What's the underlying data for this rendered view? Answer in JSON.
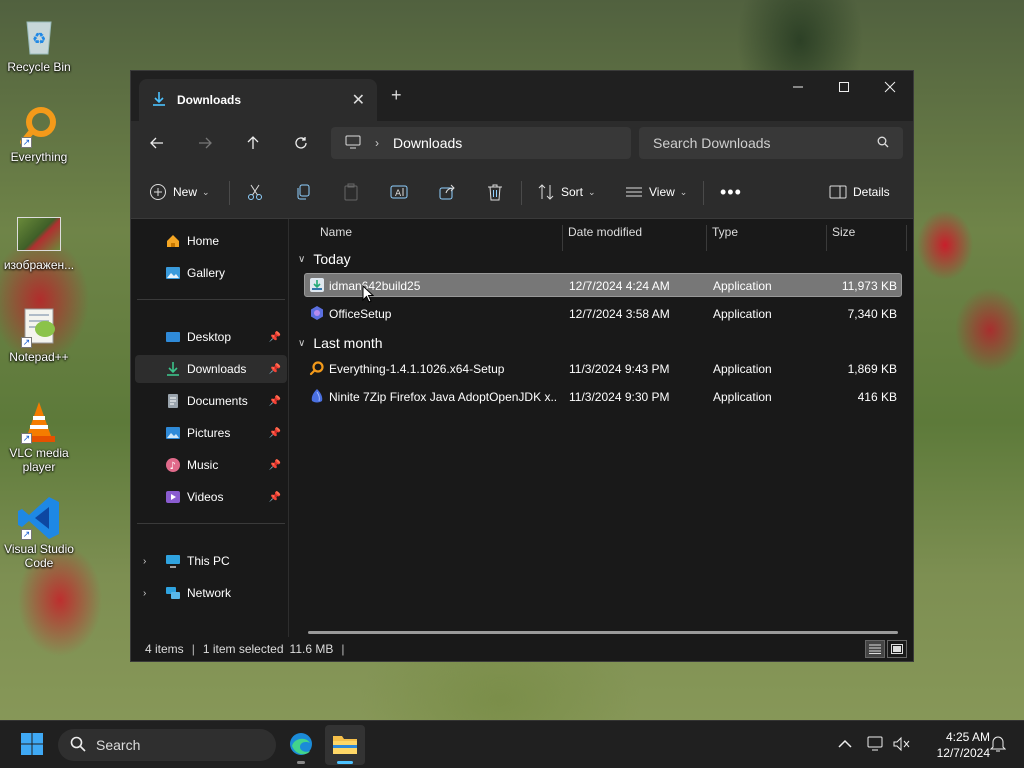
{
  "desktop": {
    "icons": [
      {
        "label": "Recycle Bin",
        "icon": "recycle-bin-icon"
      },
      {
        "label": "Everything",
        "icon": "everything-search-icon"
      },
      {
        "label": "изображен...",
        "icon": "image-thumbnail-icon"
      },
      {
        "label": "Notepad++",
        "icon": "notepad-plus-plus-icon"
      },
      {
        "label": "VLC media player",
        "icon": "vlc-cone-icon"
      },
      {
        "label": "Visual Studio Code",
        "icon": "vscode-icon"
      }
    ]
  },
  "window": {
    "tab_title": "Downloads",
    "address": {
      "location": "Downloads"
    },
    "search": {
      "placeholder": "Search Downloads"
    },
    "toolbar": {
      "new_label": "New",
      "sort_label": "Sort",
      "view_label": "View",
      "details_label": "Details"
    },
    "sidebar": {
      "items": [
        {
          "label": "Home",
          "icon": "home-icon"
        },
        {
          "label": "Gallery",
          "icon": "gallery-icon"
        },
        {
          "label": "Desktop",
          "icon": "desktop-folder-icon",
          "pinned": true
        },
        {
          "label": "Downloads",
          "icon": "downloads-folder-icon",
          "pinned": true,
          "active": true
        },
        {
          "label": "Documents",
          "icon": "documents-folder-icon",
          "pinned": true
        },
        {
          "label": "Pictures",
          "icon": "pictures-folder-icon",
          "pinned": true
        },
        {
          "label": "Music",
          "icon": "music-folder-icon",
          "pinned": true
        },
        {
          "label": "Videos",
          "icon": "videos-folder-icon",
          "pinned": true
        },
        {
          "label": "This PC",
          "icon": "this-pc-icon"
        },
        {
          "label": "Network",
          "icon": "network-icon"
        }
      ]
    },
    "columns": {
      "name": "Name",
      "date": "Date modified",
      "type": "Type",
      "size": "Size"
    },
    "groups": [
      {
        "label": "Today",
        "files": [
          {
            "name": "idman642build25",
            "date": "12/7/2024 4:24 AM",
            "type": "Application",
            "size": "11,973 KB",
            "selected": true
          },
          {
            "name": "OfficeSetup",
            "date": "12/7/2024 3:58 AM",
            "type": "Application",
            "size": "7,340 KB"
          }
        ]
      },
      {
        "label": "Last month",
        "files": [
          {
            "name": "Everything-1.4.1.1026.x64-Setup",
            "date": "11/3/2024 9:43 PM",
            "type": "Application",
            "size": "1,869 KB"
          },
          {
            "name": "Ninite 7Zip Firefox Java AdoptOpenJDK x...",
            "date": "11/3/2024 9:30 PM",
            "type": "Application",
            "size": "416 KB"
          }
        ]
      }
    ],
    "status": {
      "items": "4 items",
      "selection": "1 item selected",
      "size": "11.6 MB"
    }
  },
  "taskbar": {
    "search_placeholder": "Search",
    "time": "4:25 AM",
    "date": "12/7/2024"
  },
  "colors": {
    "accent": "#4cc2ff",
    "window_bg": "#191919",
    "selected_row": "#777777"
  }
}
